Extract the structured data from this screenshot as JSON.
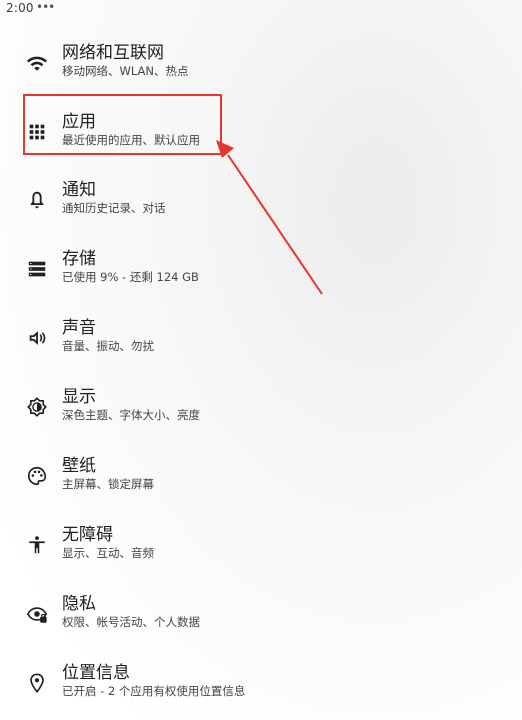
{
  "status_bar": {
    "time": "2:00",
    "dots": "•••"
  },
  "settings": {
    "items": [
      {
        "title": "网络和互联网",
        "subtitle": "移动网络、WLAN、热点",
        "icon": "wifi-icon"
      },
      {
        "title": "应用",
        "subtitle": "最近使用的应用、默认应用",
        "icon": "apps-grid-icon"
      },
      {
        "title": "通知",
        "subtitle": "通知历史记录、对话",
        "icon": "bell-icon"
      },
      {
        "title": "存储",
        "subtitle": "已使用 9% - 还剩 124 GB",
        "icon": "storage-icon"
      },
      {
        "title": "声音",
        "subtitle": "音量、振动、勿扰",
        "icon": "volume-icon"
      },
      {
        "title": "显示",
        "subtitle": "深色主题、字体大小、亮度",
        "icon": "brightness-icon"
      },
      {
        "title": "壁纸",
        "subtitle": "主屏幕、锁定屏幕",
        "icon": "palette-icon"
      },
      {
        "title": "无障碍",
        "subtitle": "显示、互动、音频",
        "icon": "accessibility-icon"
      },
      {
        "title": "隐私",
        "subtitle": "权限、帐号活动、个人数据",
        "icon": "privacy-eye-icon"
      },
      {
        "title": "位置信息",
        "subtitle": "已开启 - 2 个应用有权使用位置信息",
        "icon": "location-pin-icon"
      }
    ]
  },
  "annotation": {
    "highlight_color": "#e8352c",
    "highlighted_item": "应用"
  }
}
